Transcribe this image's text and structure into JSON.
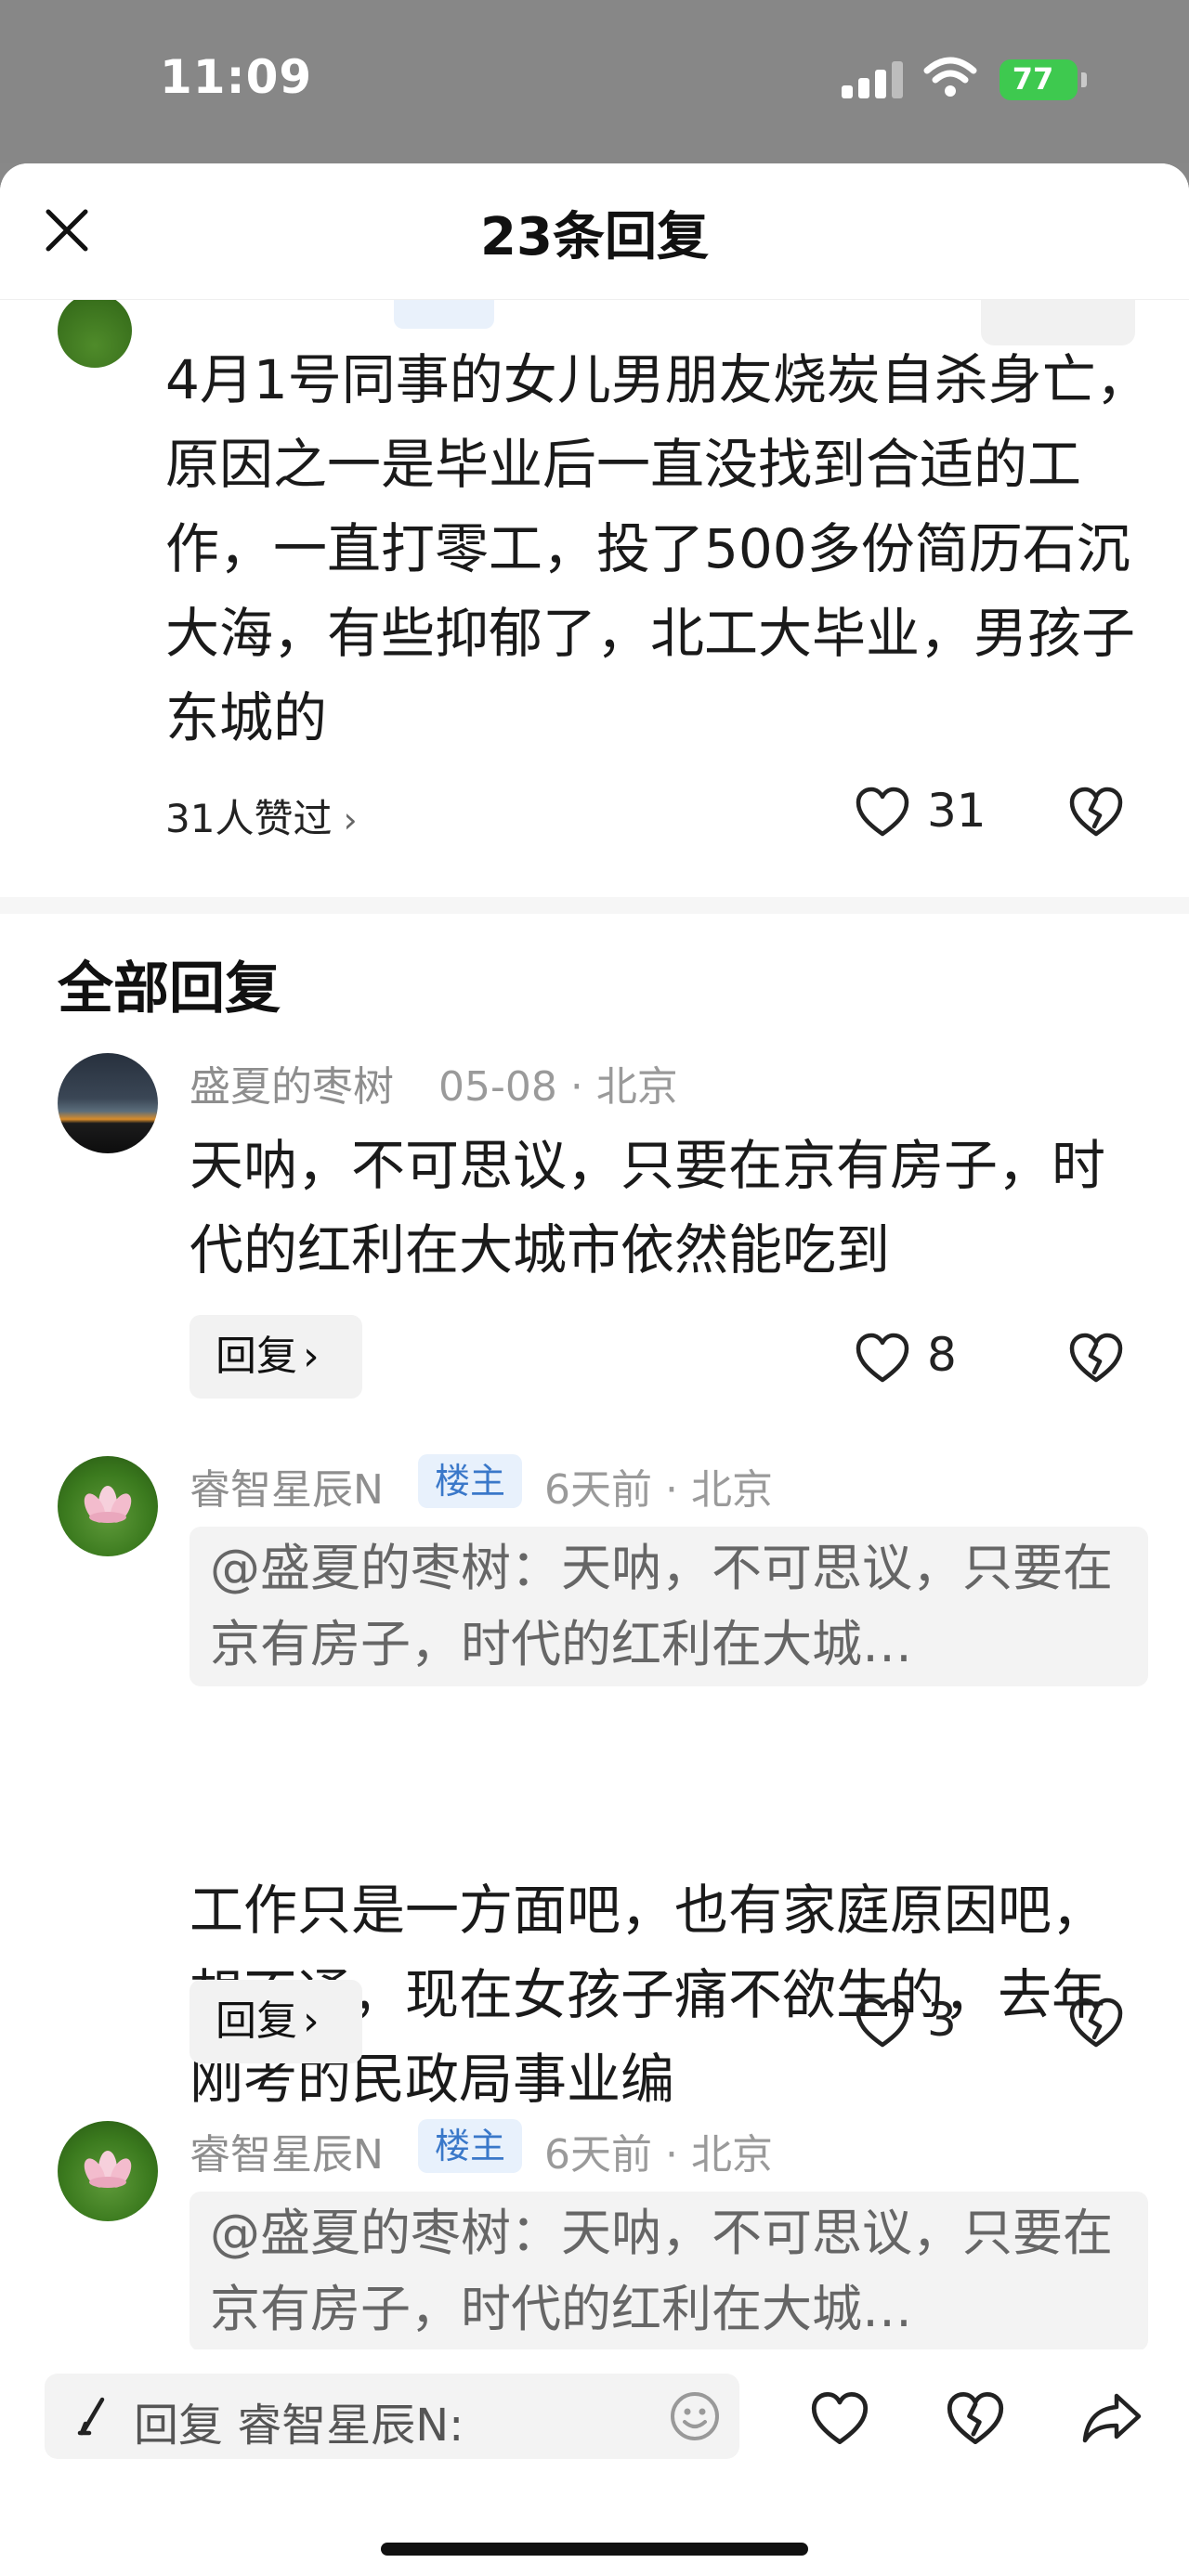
{
  "status_bar": {
    "time": "11:09",
    "battery": "77",
    "icons": [
      "signal-icon",
      "wifi-icon",
      "battery-icon"
    ]
  },
  "header": {
    "title": "23条回复",
    "close_icon": "close-icon"
  },
  "op": {
    "text": "4月1号同事的女儿男朋友烧炭自杀身亡，原因之一是毕业后一直没找到合适的工作，一直打零工，投了500多份简历石沉大海，有些抑郁了，北工大毕业，男孩子东城的",
    "likers": "31人赞过",
    "likers_chevron": "›",
    "like_count": "31"
  },
  "section": {
    "title": "全部回复"
  },
  "comments": [
    {
      "name": "盛夏的枣树",
      "meta": "05-08 · 北京",
      "text": "天呐，不可思议，只要在京有房子，时代的红利在大城市依然能吃到",
      "reply_label": "回复",
      "reply_chevron": "›",
      "like_count": "8"
    },
    {
      "name": "睿智星辰N",
      "badge": "楼主",
      "meta": "6天前 · 北京",
      "quote": "@盛夏的枣树：天呐，不可思议，只要在京有房子，时代的红利在大城…",
      "text": "工作只是一方面吧，也有家庭原因吧，想不通，现在女孩子痛不欲生的，去年刚考的民政局事业编",
      "reply_label": "回复",
      "reply_chevron": "›",
      "like_count": "3"
    },
    {
      "name": "睿智星辰N",
      "badge": "楼主",
      "meta": "6天前 · 北京",
      "quote": "@盛夏的枣树：天呐，不可思议，只要在京有房子，时代的红利在大城…"
    }
  ],
  "bottom_bar": {
    "reply_placeholder": "回复 睿智星辰N:",
    "icons": [
      "pen-icon",
      "emoji-icon",
      "like-icon",
      "dislike-icon",
      "share-icon"
    ]
  },
  "colors": {
    "status_bar_bg": "#878787",
    "battery_green": "#3ec94f",
    "host_badge_bg": "#e8f1fc",
    "host_badge_text": "#3a78c9"
  }
}
